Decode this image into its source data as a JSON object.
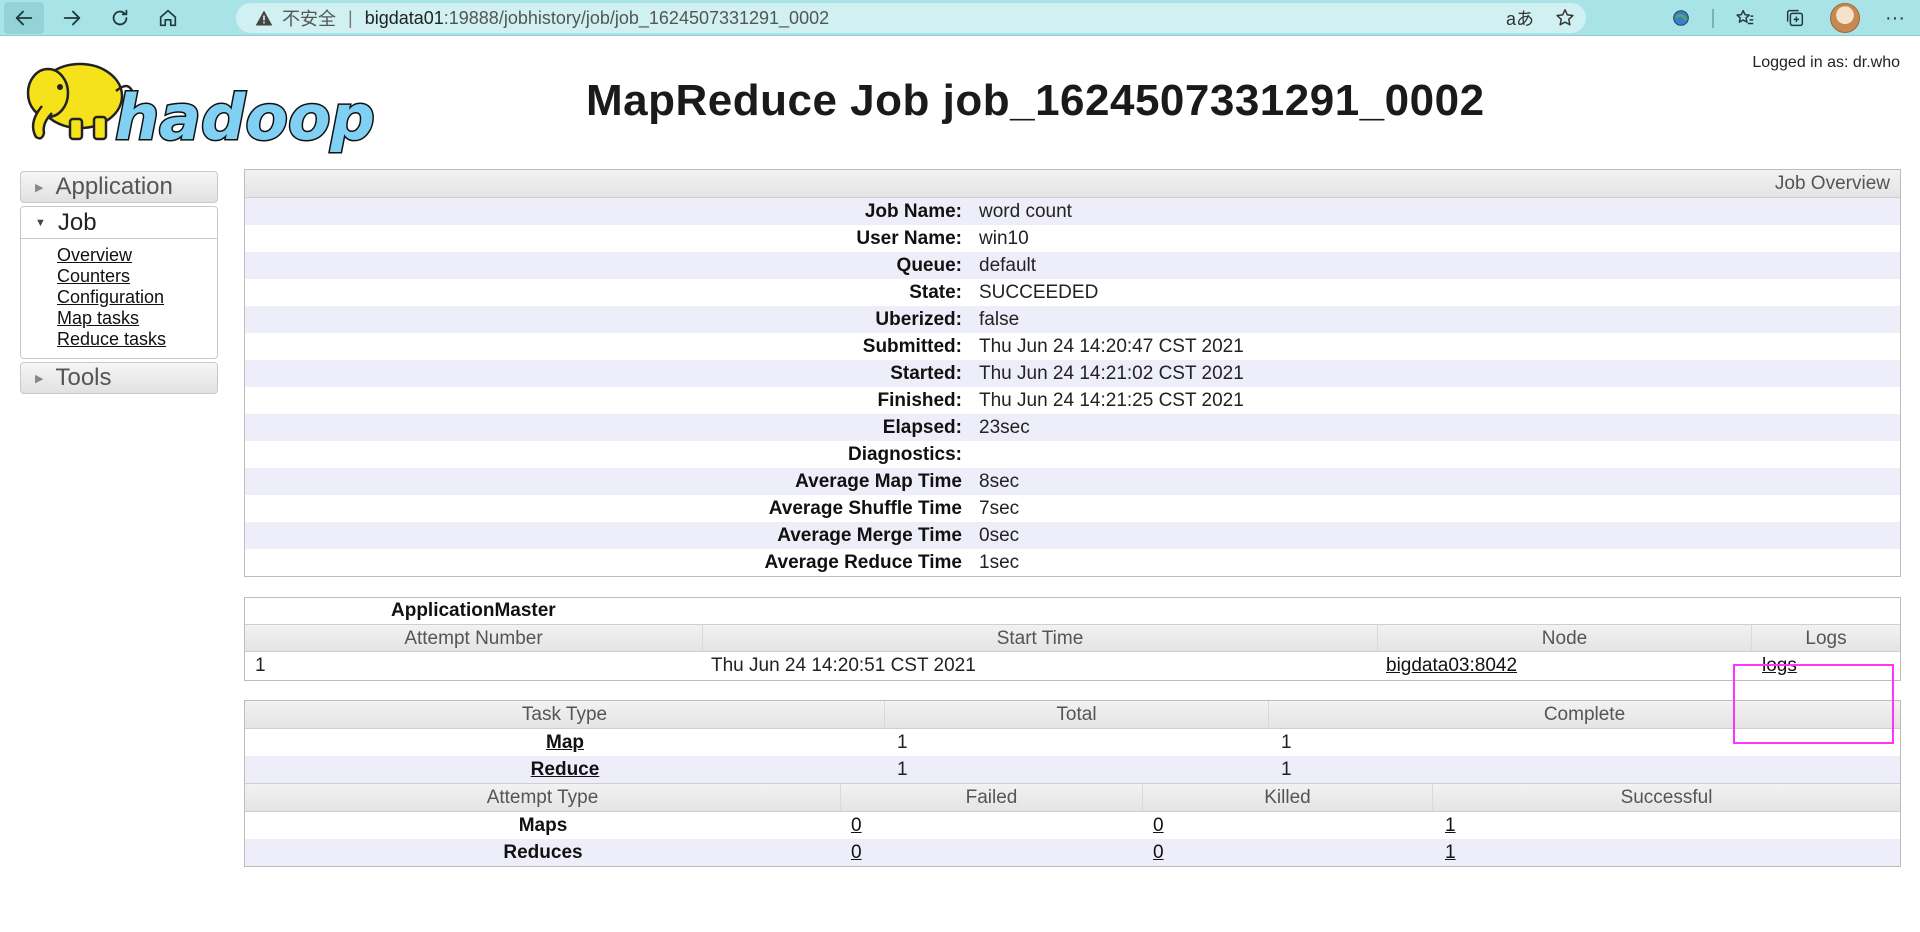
{
  "browser": {
    "insecure_label": "不安全",
    "separator": "|",
    "url_host": "bigdata01",
    "url_path": ":19888/jobhistory/job/job_1624507331291_0002",
    "read_aloud_label": "aあ"
  },
  "header": {
    "logged_in": "Logged in as: dr.who",
    "title": "MapReduce Job job_1624507331291_0002",
    "logo_text": "hadoop"
  },
  "sidebar": {
    "application": "Application",
    "job": "Job",
    "links": [
      "Overview",
      "Counters",
      "Configuration",
      "Map tasks",
      "Reduce tasks"
    ],
    "tools": "Tools"
  },
  "overview": {
    "header": "Job Overview",
    "rows": [
      {
        "key": "Job Name:",
        "value": "word count"
      },
      {
        "key": "User Name:",
        "value": "win10"
      },
      {
        "key": "Queue:",
        "value": "default"
      },
      {
        "key": "State:",
        "value": "SUCCEEDED"
      },
      {
        "key": "Uberized:",
        "value": "false"
      },
      {
        "key": "Submitted:",
        "value": "Thu Jun 24 14:20:47 CST 2021"
      },
      {
        "key": "Started:",
        "value": "Thu Jun 24 14:21:02 CST 2021"
      },
      {
        "key": "Finished:",
        "value": "Thu Jun 24 14:21:25 CST 2021"
      },
      {
        "key": "Elapsed:",
        "value": "23sec"
      },
      {
        "key": "Diagnostics:",
        "value": ""
      },
      {
        "key": "Average Map Time",
        "value": "8sec"
      },
      {
        "key": "Average Shuffle Time",
        "value": "7sec"
      },
      {
        "key": "Average Merge Time",
        "value": "0sec"
      },
      {
        "key": "Average Reduce Time",
        "value": "1sec"
      }
    ]
  },
  "app_master": {
    "title": "ApplicationMaster",
    "headers": [
      "Attempt Number",
      "Start Time",
      "Node",
      "Logs"
    ],
    "row": {
      "attempt": "1",
      "start": "Thu Jun 24 14:20:51 CST 2021",
      "node": "bigdata03:8042",
      "logs": "logs"
    }
  },
  "tasks": {
    "headers": [
      "Task Type",
      "Total",
      "Complete"
    ],
    "rows": [
      {
        "type": "Map",
        "total": "1",
        "complete": "1"
      },
      {
        "type": "Reduce",
        "total": "1",
        "complete": "1"
      }
    ],
    "attempt_headers": [
      "Attempt Type",
      "Failed",
      "Killed",
      "Successful"
    ],
    "attempt_rows": [
      {
        "type": "Maps",
        "failed": "0",
        "killed": "0",
        "successful": "1"
      },
      {
        "type": "Reduces",
        "failed": "0",
        "killed": "0",
        "successful": "1"
      }
    ]
  },
  "colors": {
    "chrome": "#a8e3e7",
    "address_bar": "#d1f0f2",
    "alt_row": "#eeeefa",
    "highlight_box": "#ff33ff",
    "logo_yellow": "#f5e21b"
  }
}
